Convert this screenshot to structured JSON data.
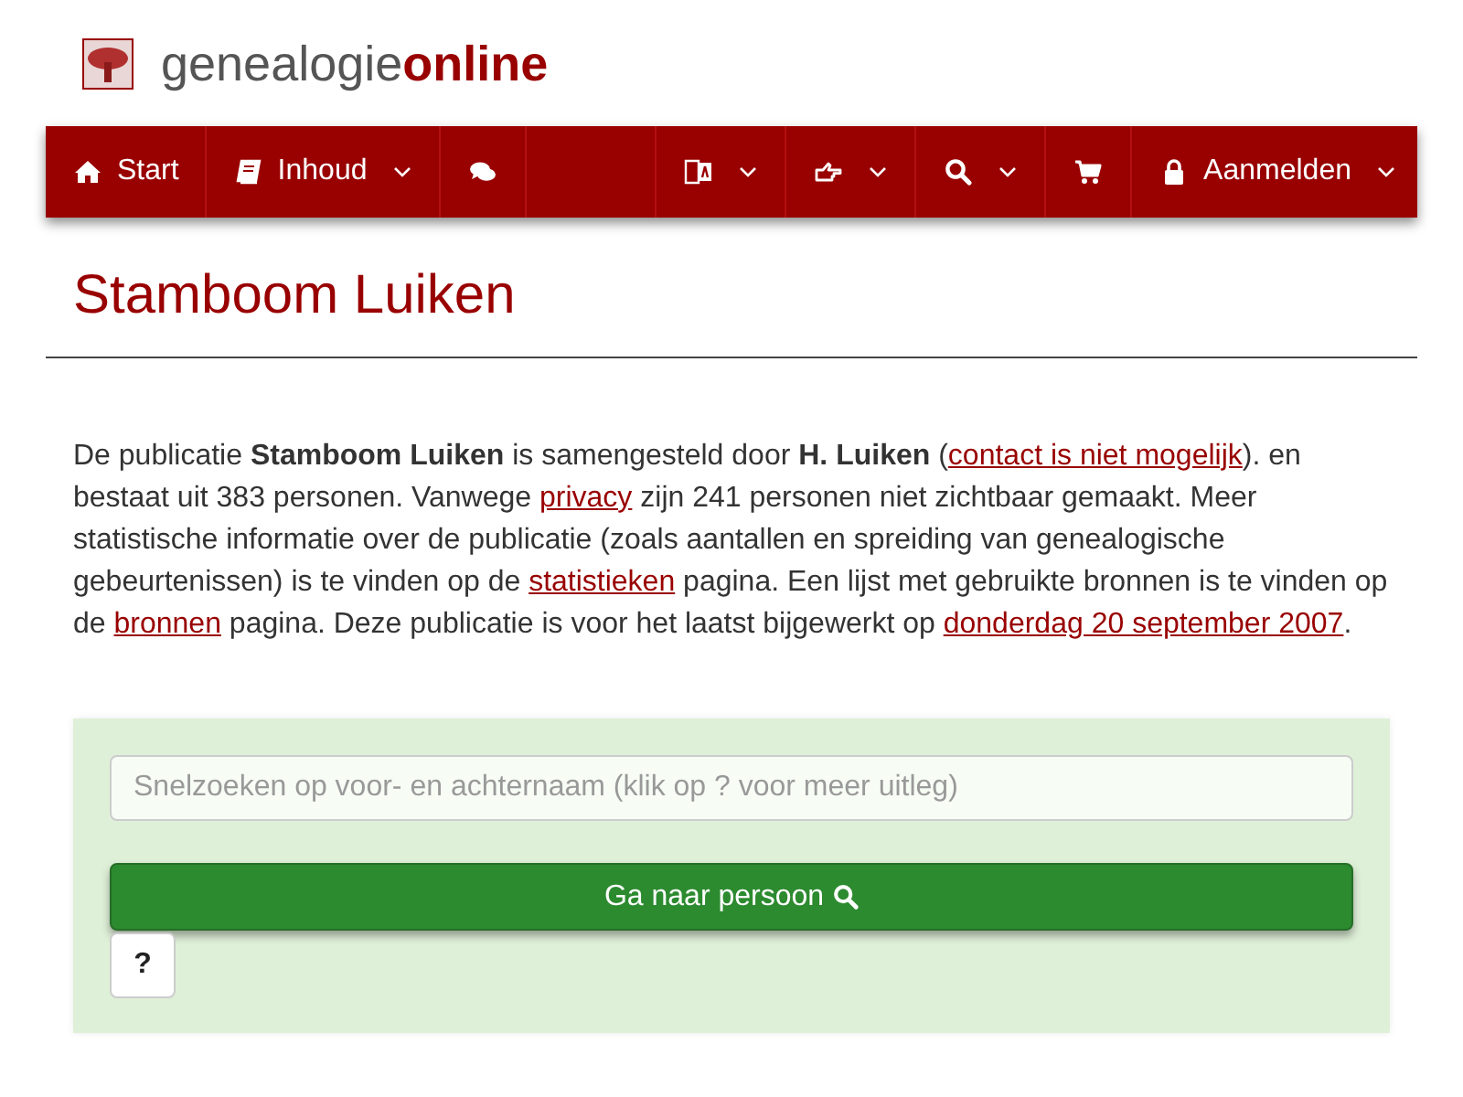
{
  "logo": {
    "brand_plain": "genealogie",
    "brand_bold": "online"
  },
  "nav": {
    "left": [
      {
        "kind": "home",
        "label": "Start",
        "caret": false
      },
      {
        "kind": "book",
        "label": "Inhoud",
        "caret": true
      },
      {
        "kind": "chat",
        "caret": false
      }
    ],
    "right": [
      {
        "kind": "translate",
        "caret": true
      },
      {
        "kind": "hand",
        "caret": true
      },
      {
        "kind": "search",
        "caret": true
      },
      {
        "kind": "cart",
        "caret": false
      },
      {
        "kind": "lock",
        "label": "Aanmelden",
        "caret": true
      }
    ]
  },
  "title": "Stamboom Luiken",
  "intro": [
    {
      "text": "De publicatie **Stamboom Luiken** is samengesteld door **H. Luiken** ("
    },
    {
      "text": "contact is niet mogelijk",
      "link": true
    },
    {
      "text": "). en bestaat uit 383 personen. Vanwege "
    },
    {
      "text": "privacy",
      "link": true
    },
    {
      "text": " zijn 241 personen niet zichtbaar gemaakt. Meer statistische informatie over de publicatie (zoals aantallen en spreiding van genealogische gebeurtenissen) is te vinden op de "
    },
    {
      "text": "statistieken",
      "link": true
    },
    {
      "text": " pagina. Een lijst met gebruikte bronnen is te vinden op de "
    },
    {
      "text": "bronnen",
      "link": true
    },
    {
      "text": " pagina. Deze publicatie is voor het laatst bijgewerkt op "
    },
    {
      "text": "donderdag 20 september 2007",
      "link": true
    },
    {
      "text": "."
    }
  ],
  "search": {
    "placeholder": "Snelzoeken op voor- en achternaam (klik op ? voor meer uitleg)",
    "button": "Ga naar persoon",
    "help": "?"
  }
}
